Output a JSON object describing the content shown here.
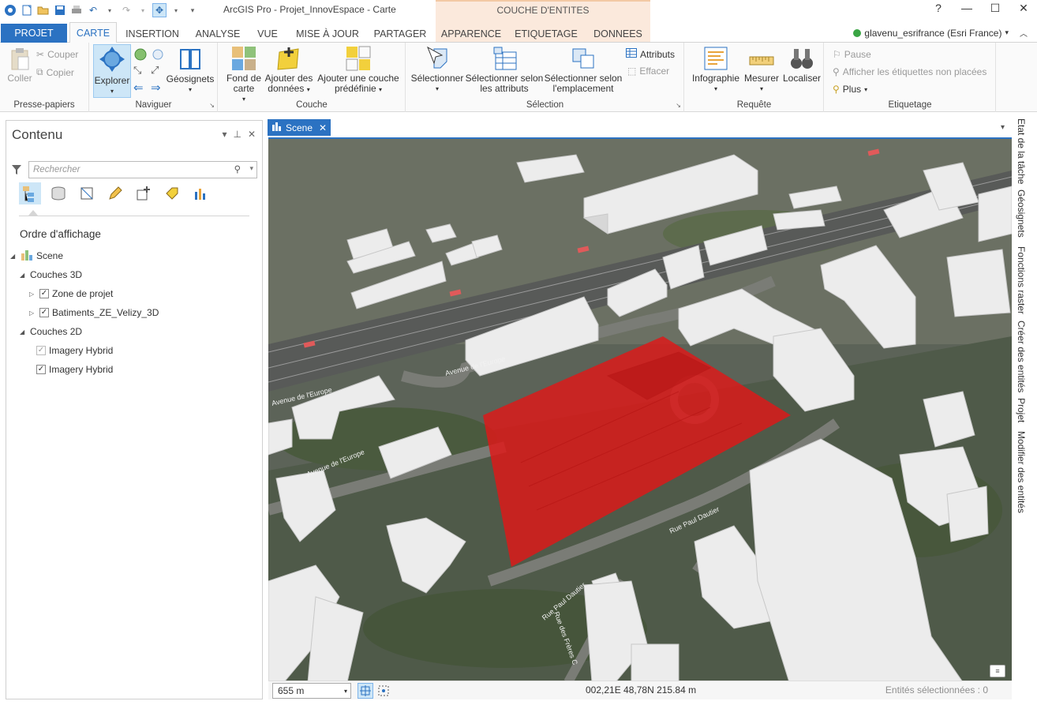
{
  "title": {
    "app_title": "ArcGIS Pro - Projet_InnovEspace - Carte",
    "context_group": "COUCHE D'ENTITES",
    "help": "?"
  },
  "tabs": [
    "PROJET",
    "CARTE",
    "INSERTION",
    "ANALYSE",
    "VUE",
    "MISE À JOUR",
    "PARTAGER",
    "APPARENCE",
    "ETIQUETAGE",
    "DONNEES"
  ],
  "user": "glavenu_esrifrance (Esri France)",
  "ribbon": {
    "clipboard": {
      "paste": "Coller",
      "cut": "Couper",
      "copy": "Copier",
      "label": "Presse-papiers"
    },
    "navigate": {
      "explore": "Explorer",
      "bookmarks": "Géosignets",
      "label": "Naviguer"
    },
    "layer": {
      "basemap": "Fond de carte",
      "add_data": "Ajouter des données",
      "add_preset": "Ajouter une couche prédéfinie",
      "label": "Couche"
    },
    "selection": {
      "select": "Sélectionner",
      "select_by_attr": "Sélectionner selon les attributs",
      "select_by_loc": "Sélectionner selon l'emplacement",
      "attributes": "Attributs",
      "clear": "Effacer",
      "label": "Sélection"
    },
    "inquiry": {
      "infographic": "Infographie",
      "measure": "Mesurer",
      "locate": "Localiser",
      "label": "Requête"
    },
    "labeling": {
      "pause": "Pause",
      "show_unplaced": "Afficher les étiquettes non placées",
      "more": "Plus",
      "label": "Etiquetage"
    }
  },
  "contents": {
    "title": "Contenu",
    "search_placeholder": "Rechercher",
    "section": "Ordre d'affichage",
    "tree": {
      "scene": "Scene",
      "group3d": "Couches 3D",
      "layer1": "Zone de projet",
      "layer2": "Batiments_ZE_Velizy_3D",
      "group2d": "Couches 2D",
      "layer3": "Imagery Hybrid",
      "layer4": "Imagery Hybrid"
    }
  },
  "view": {
    "tab": "Scene",
    "labels": {
      "street1": "Avenue de l'Europe",
      "street2": "Avenue de l'Europe",
      "street3": "Rue Paul Dautier",
      "street4": "Rue Paul Dautier",
      "street5": "Rue des Frères C",
      "street6": "Avenue de l'Europe"
    }
  },
  "status": {
    "scale": "655 m",
    "coords": "002,21E 48,78N  215.84 m",
    "selected": "Entités sélectionnées : 0"
  },
  "dock_tabs": [
    "Etat de la tâche",
    "Géosignets",
    "Fonctions raster",
    "Créer des entités",
    "Projet",
    "Modifier des entités"
  ],
  "colors": {
    "accent": "#2b72c2",
    "selection": "#e01717",
    "context": "#fbe9dc"
  }
}
